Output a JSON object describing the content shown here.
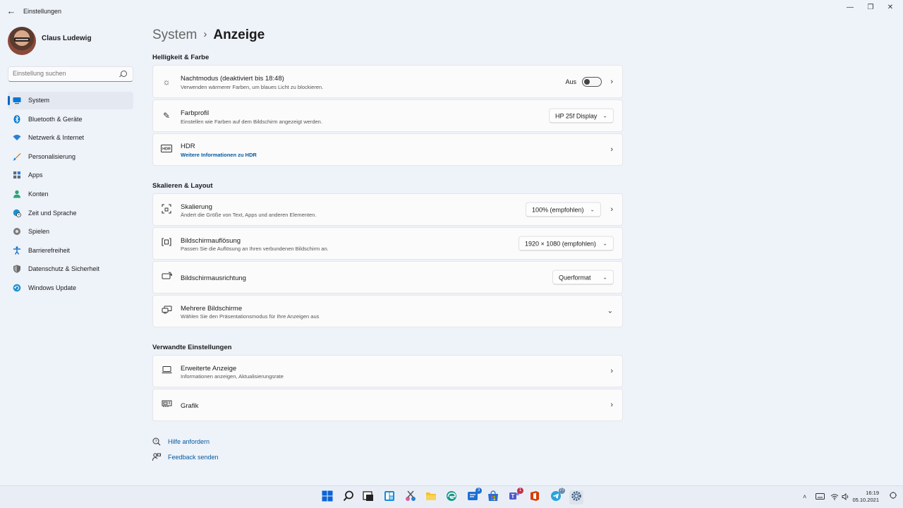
{
  "window": {
    "title": "Einstellungen",
    "back_icon": "back-arrow-icon",
    "controls": [
      "—",
      "❐",
      "✕"
    ]
  },
  "user": {
    "name": "Claus Ludewig"
  },
  "search": {
    "placeholder": "Einstellung suchen"
  },
  "nav": {
    "active": "System",
    "items": [
      {
        "label": "System",
        "icon": "display-icon",
        "color": "#0078d4"
      },
      {
        "label": "Bluetooth & Geräte",
        "icon": "bluetooth-icon",
        "color": "#0078d4"
      },
      {
        "label": "Netzwerk & Internet",
        "icon": "wifi-icon",
        "color": "#2a7fd6"
      },
      {
        "label": "Personalisierung",
        "icon": "brush-icon",
        "color": "#d08b2a"
      },
      {
        "label": "Apps",
        "icon": "apps-icon",
        "color": "#5a6b7a"
      },
      {
        "label": "Konten",
        "icon": "person-icon",
        "color": "#2fa37a"
      },
      {
        "label": "Zeit und Sprache",
        "icon": "globe-clock-icon",
        "color": "#1f8fcf"
      },
      {
        "label": "Spielen",
        "icon": "gamepad-icon",
        "color": "#6b6b6b"
      },
      {
        "label": "Barrierefreiheit",
        "icon": "accessibility-icon",
        "color": "#1a73c9"
      },
      {
        "label": "Datenschutz & Sicherheit",
        "icon": "shield-icon",
        "color": "#6b6b6b"
      },
      {
        "label": "Windows Update",
        "icon": "update-icon",
        "color": "#1f8fcf"
      }
    ]
  },
  "breadcrumb": {
    "parent": "System",
    "current": "Anzeige"
  },
  "sections": {
    "brightness": "Helligkeit & Farbe",
    "scale": "Skalieren & Layout",
    "related": "Verwandte Einstellungen"
  },
  "cards": {
    "night": {
      "title": "Nachtmodus (deaktiviert bis 18:48)",
      "subtitle": "Verwenden wärmerer Farben, um blaues Licht zu blockieren.",
      "toggle_label": "Aus",
      "toggle_on": false
    },
    "color_profile": {
      "title": "Farbprofil",
      "subtitle": "Einstellen wie Farben auf dem Bildschirm angezeigt werden.",
      "value": "HP 25f Display"
    },
    "hdr": {
      "title": "HDR",
      "link": "Weitere Informationen zu HDR"
    },
    "scaling": {
      "title": "Skalierung",
      "subtitle": "Ändert die Größe von Text, Apps und anderen Elementen.",
      "value": "100% (empfohlen)"
    },
    "resolution": {
      "title": "Bildschirmauflösung",
      "subtitle": "Passen Sie die Auflösung an Ihren verbundenen Bildschirm an.",
      "value": "1920 × 1080 (empfohlen)"
    },
    "orientation": {
      "title": "Bildschirmausrichtung",
      "value": "Querformat"
    },
    "multi": {
      "title": "Mehrere Bildschirme",
      "subtitle": "Wählen Sie den Präsentationsmodus für Ihre Anzeigen aus"
    },
    "advanced": {
      "title": "Erweiterte Anzeige",
      "subtitle": "Informationen anzeigen, Aktualisierungsrate"
    },
    "graphics": {
      "title": "Grafik"
    }
  },
  "help": {
    "get_help": "Hilfe anfordern",
    "feedback": "Feedback senden"
  },
  "taskbar": {
    "apps": [
      {
        "name": "start-icon",
        "badge": ""
      },
      {
        "name": "search-icon",
        "badge": ""
      },
      {
        "name": "task-view-icon",
        "badge": ""
      },
      {
        "name": "widgets-icon",
        "badge": ""
      },
      {
        "name": "snipping-icon",
        "badge": ""
      },
      {
        "name": "file-explorer-icon",
        "badge": ""
      },
      {
        "name": "edge-icon",
        "badge": ""
      },
      {
        "name": "app-icon",
        "badge": "3"
      },
      {
        "name": "store-icon",
        "badge": ""
      },
      {
        "name": "teams-icon",
        "badge": "1"
      },
      {
        "name": "office-icon",
        "badge": ""
      },
      {
        "name": "telegram-icon",
        "badge": "77"
      },
      {
        "name": "settings-icon",
        "badge": ""
      }
    ],
    "time": "16:19",
    "date": "05.10.2021"
  }
}
